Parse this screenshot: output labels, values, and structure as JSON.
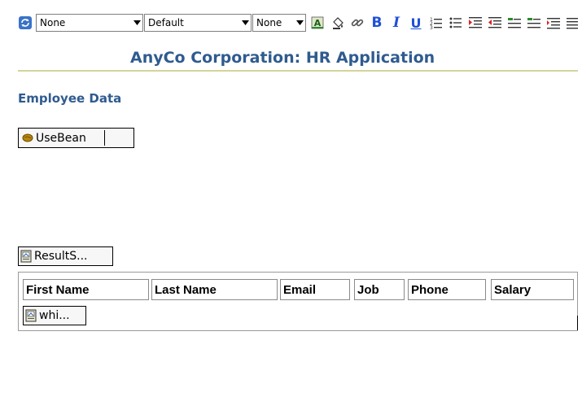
{
  "toolbar": {
    "style_select": "None",
    "font_select": "Default",
    "size_select": "None",
    "icons": [
      "refresh-icon",
      "highlight-icon",
      "fill-color-icon",
      "link-icon",
      "bold-icon",
      "italic-icon",
      "underline-icon",
      "numbered-list-icon",
      "bulleted-list-icon",
      "indent-icon",
      "outdent-icon",
      "align-icon"
    ],
    "bold_label": "B",
    "italic_label": "I",
    "underline_label": "U"
  },
  "page": {
    "title": "AnyCo Corporation: HR Application",
    "section_title": "Employee Data"
  },
  "tags": {
    "usebean_label": "UseBean",
    "resultset_label": "ResultS...",
    "while_label": "whi..."
  },
  "table": {
    "headers": [
      "First Name",
      "Last Name",
      "Email",
      "Job",
      "Phone",
      "Salary"
    ]
  },
  "colors": {
    "title": "#2f5b8f",
    "divider": "#d6d39a",
    "bold_button": "#1f4fd6"
  }
}
